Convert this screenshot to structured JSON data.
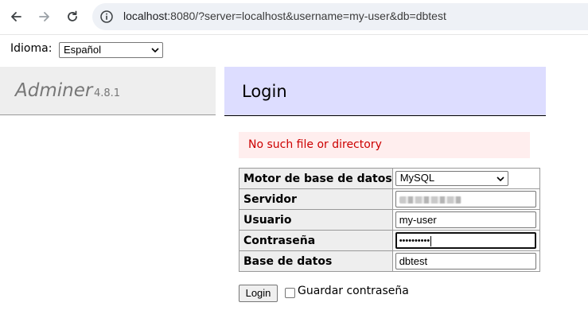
{
  "browser": {
    "url_host": "localhost",
    "url_rest": ":8080/?server=localhost&username=my-user&db=dbtest"
  },
  "language": {
    "label": "Idioma:",
    "selected": "Español"
  },
  "sidebar": {
    "brand": "Adminer",
    "version": "4.8.1"
  },
  "content": {
    "title": "Login",
    "error": "No such file or directory"
  },
  "login_form": {
    "fields": [
      {
        "label": "Motor de base de datos",
        "value": "MySQL"
      },
      {
        "label": "Servidor",
        "value": ""
      },
      {
        "label": "Usuario",
        "value": "my-user"
      },
      {
        "label": "Contraseña",
        "value": "••••••••••"
      },
      {
        "label": "Base de datos",
        "value": "dbtest"
      }
    ],
    "submit_label": "Login",
    "remember_label": "Guardar contraseña"
  }
}
